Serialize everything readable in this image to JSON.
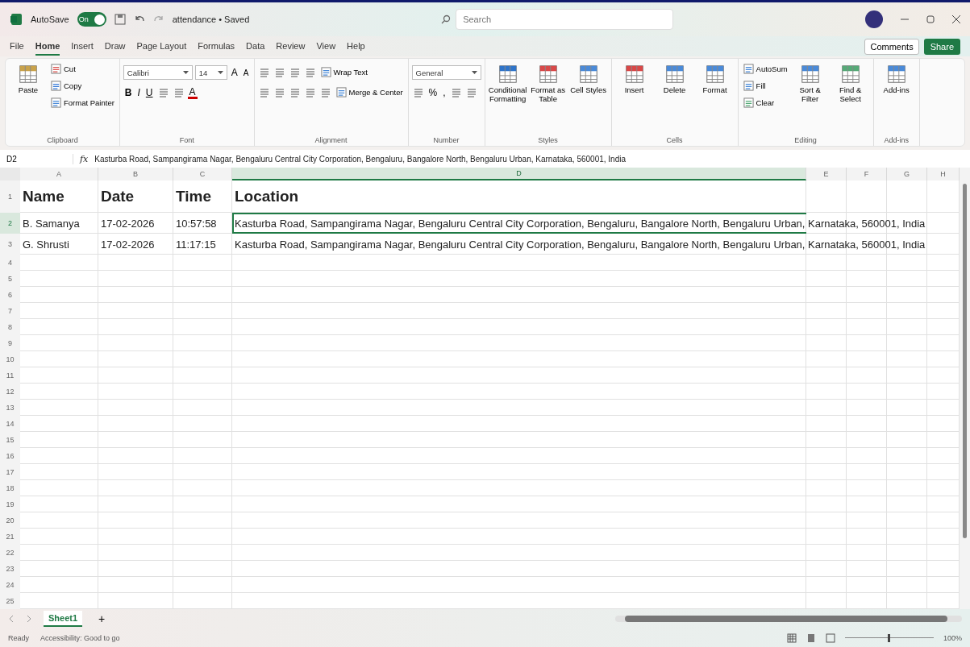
{
  "title_bar": {
    "autosave_label": "AutoSave",
    "autosave": {
      "label": "On",
      "on": true
    },
    "title": "attendance • Saved",
    "search": {
      "placeholder": "Search"
    }
  },
  "menu_tabs": [
    {
      "label": "File",
      "selected": false
    },
    {
      "label": "Home",
      "selected": true
    },
    {
      "label": "Insert",
      "selected": false
    },
    {
      "label": "Draw",
      "selected": false
    },
    {
      "label": "Page Layout",
      "selected": false
    },
    {
      "label": "Formulas",
      "selected": false
    },
    {
      "label": "Data",
      "selected": false
    },
    {
      "label": "Review",
      "selected": false
    },
    {
      "label": "View",
      "selected": false
    },
    {
      "label": "Help",
      "selected": false
    }
  ],
  "comments": "Comments",
  "share": "Share",
  "ribbon": [
    {
      "name": "Clipboard",
      "stacks": [
        [
          {
            "kind": "large",
            "label": "Paste"
          }
        ],
        [
          {
            "kind": "small",
            "label": "Cut"
          },
          {
            "kind": "small",
            "label": "Copy"
          },
          {
            "kind": "small",
            "label": "Format Painter"
          }
        ]
      ]
    },
    {
      "name": "Font",
      "lines": [
        [
          {
            "kind": "field",
            "value": "Calibri"
          },
          {
            "kind": "field",
            "value": "14"
          },
          {
            "kind": "grow",
            "label": "A"
          },
          {
            "kind": "shrink",
            "label": "A"
          }
        ],
        [
          {
            "kind": "bold",
            "label": "B"
          },
          {
            "kind": "italic",
            "label": "I"
          },
          {
            "kind": "underline",
            "label": "U"
          },
          {
            "kind": "icon"
          },
          {
            "kind": "icon"
          },
          {
            "kind": "font-color",
            "label": "A"
          }
        ]
      ]
    },
    {
      "name": "Alignment",
      "lines": [
        [
          {
            "kind": "icon"
          },
          {
            "kind": "icon"
          },
          {
            "kind": "icon"
          },
          {
            "kind": "icon"
          },
          {
            "kind": "small",
            "label": "Wrap Text"
          }
        ],
        [
          {
            "kind": "icon"
          },
          {
            "kind": "icon"
          },
          {
            "kind": "icon"
          },
          {
            "kind": "icon"
          },
          {
            "kind": "icon"
          },
          {
            "kind": "small",
            "label": "Merge & Center"
          }
        ]
      ]
    },
    {
      "name": "Number",
      "lines": [
        [
          {
            "kind": "field",
            "value": "General"
          }
        ],
        [
          {
            "kind": "icon"
          },
          {
            "kind": "percent",
            "label": "%"
          },
          {
            "kind": "comma",
            "label": ","
          },
          {
            "kind": "icon"
          },
          {
            "kind": "icon"
          }
        ]
      ]
    },
    {
      "name": "Styles",
      "stacks": [
        [
          {
            "kind": "large",
            "label": "Conditional Formatting"
          }
        ],
        [
          {
            "kind": "large",
            "label": "Format as Table"
          }
        ],
        [
          {
            "kind": "large",
            "label": "Cell Styles"
          }
        ]
      ]
    },
    {
      "name": "Cells",
      "stacks": [
        [
          {
            "kind": "large",
            "label": "Insert"
          }
        ],
        [
          {
            "kind": "large",
            "label": "Delete"
          }
        ],
        [
          {
            "kind": "large",
            "label": "Format"
          }
        ]
      ]
    },
    {
      "name": "Editing",
      "stacks": [
        [
          {
            "kind": "small",
            "label": "AutoSum"
          },
          {
            "kind": "small",
            "label": "Fill"
          },
          {
            "kind": "small",
            "label": "Clear"
          }
        ],
        [
          {
            "kind": "large",
            "label": "Sort & Filter"
          }
        ],
        [
          {
            "kind": "large",
            "label": "Find & Select"
          }
        ]
      ]
    },
    {
      "name": "Add-ins",
      "stacks": [
        [
          {
            "kind": "large",
            "label": "Add-ins"
          }
        ]
      ]
    }
  ],
  "formula_bar": {
    "name_box": "D2",
    "fx": "fx",
    "formula": "Kasturba Road, Sampangirama Nagar, Bengaluru Central City Corporation, Bengaluru, Bangalore North, Bengaluru Urban, Karnataka, 560001, India"
  },
  "sheet": {
    "columns": [
      {
        "label": "A",
        "selected": false
      },
      {
        "label": "B",
        "selected": false
      },
      {
        "label": "C",
        "selected": false
      },
      {
        "label": "D",
        "selected": true
      },
      {
        "label": "E",
        "selected": false
      },
      {
        "label": "F",
        "selected": false
      },
      {
        "label": "G",
        "selected": false
      },
      {
        "label": "H",
        "selected": false
      }
    ],
    "rows": [
      {
        "number": "1",
        "kind": "heading",
        "selected": false,
        "cells": [
          {
            "text": "Name",
            "selected": false
          },
          {
            "text": "Date",
            "selected": false
          },
          {
            "text": "Time",
            "selected": false
          },
          {
            "text": "Location",
            "selected": false
          }
        ]
      },
      {
        "number": "2",
        "kind": "data",
        "selected": true,
        "cells": [
          {
            "text": "B. Samanya",
            "selected": false
          },
          {
            "text": "17-02-2026",
            "selected": false
          },
          {
            "text": "10:57:58",
            "selected": false
          },
          {
            "text": "Kasturba Road, Sampangirama Nagar, Bengaluru Central City Corporation, Bengaluru, Bangalore North, Bengaluru Urban, Karnataka, 560001, India",
            "selected": true
          }
        ]
      },
      {
        "number": "3",
        "kind": "data",
        "selected": false,
        "cells": [
          {
            "text": "G. Shrusti",
            "selected": false
          },
          {
            "text": "17-02-2026",
            "selected": false
          },
          {
            "text": "11:17:15",
            "selected": false
          },
          {
            "text": "Kasturba Road, Sampangirama Nagar, Bengaluru Central City Corporation, Bengaluru, Bangalore North, Bengaluru Urban, Karnataka, 560001, India",
            "selected": false
          }
        ]
      },
      {
        "number": "4"
      },
      {
        "number": "5"
      },
      {
        "number": "6"
      },
      {
        "number": "7"
      },
      {
        "number": "8"
      },
      {
        "number": "9"
      },
      {
        "number": "10"
      },
      {
        "number": "11"
      },
      {
        "number": "12"
      },
      {
        "number": "13"
      },
      {
        "number": "14"
      },
      {
        "number": "15"
      },
      {
        "number": "16"
      },
      {
        "number": "17"
      },
      {
        "number": "18"
      },
      {
        "number": "19"
      },
      {
        "number": "20"
      },
      {
        "number": "21"
      },
      {
        "number": "22"
      },
      {
        "number": "23"
      },
      {
        "number": "24"
      },
      {
        "number": "25"
      }
    ]
  },
  "sheet_tabs": [
    {
      "label": "Sheet1",
      "selected": true
    }
  ],
  "add_sheet": "+",
  "status_bar": {
    "ready": "Ready",
    "accessibility": "Accessibility: Good to go",
    "zoom_slider": {
      "level": 0.5
    },
    "zoom": "100%"
  }
}
